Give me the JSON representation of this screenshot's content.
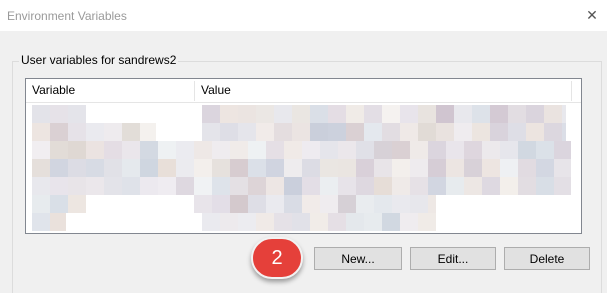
{
  "window": {
    "title": "Environment Variables",
    "close_glyph": "✕"
  },
  "user_variables": {
    "group_label": "User variables for sandrews2",
    "columns": {
      "variable": "Variable",
      "value": "Value"
    }
  },
  "buttons": {
    "new_label": "New...",
    "edit_label": "Edit...",
    "delete_label": "Delete"
  },
  "callout": {
    "step_number": "2",
    "color": "#e5403a"
  },
  "colors": {
    "blur_palette": [
      "#e8e4e8",
      "#d9d3dc",
      "#cfc4cf",
      "#e9e1de",
      "#d6cfd6",
      "#e2dde6",
      "#dcdce4",
      "#cfd6e0",
      "#e6dcd6",
      "#ddd6d0",
      "#d3c7cb",
      "#e4e8ec",
      "#c9cedb",
      "#f0ebe7"
    ]
  }
}
